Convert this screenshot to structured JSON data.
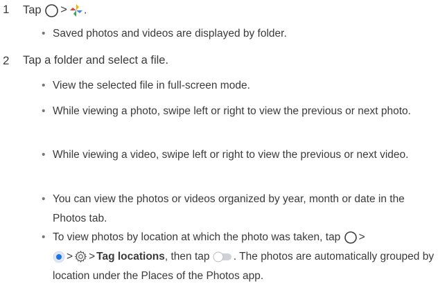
{
  "steps": [
    {
      "number": "1",
      "text_a": "Tap",
      "sep": ">",
      "end": "."
    },
    {
      "number": "2",
      "text": "Tap a folder and select a file."
    }
  ],
  "bullets": {
    "b1": "Saved photos and videos are displayed by folder.",
    "b2": "View the selected file in full-screen mode.",
    "b3": "While viewing a photo, swipe left or right to view the previous or next photo.",
    "b4": "While viewing a video, swipe left or right to view the previous or next video.",
    "b5": "You can view the photos or videos organized by year, month or date in the Photos tab.",
    "b6_a": "To view photos by location at which the photo was taken, tap",
    "b6_sep": ">",
    "b6_bold": "Tag locations",
    "b6_b": ", then tap",
    "b6_c": ". The photos are automatically grouped by location under the Places of the Photos app."
  },
  "bullet_char": "•",
  "icons": {
    "home": "home-circle-icon",
    "photos": "pinwheel-photos-icon",
    "menu": "blue-dot-icon",
    "settings": "settings-gear-icon",
    "toggle": "toggle-switch-icon"
  },
  "colors": {
    "text": "#3a3a3a",
    "pinwheel_yellow": "#f4b400",
    "pinwheel_red": "#e94235",
    "pinwheel_blue": "#4285f4",
    "pinwheel_green": "#34a853",
    "accent_blue": "#1a73e8"
  }
}
